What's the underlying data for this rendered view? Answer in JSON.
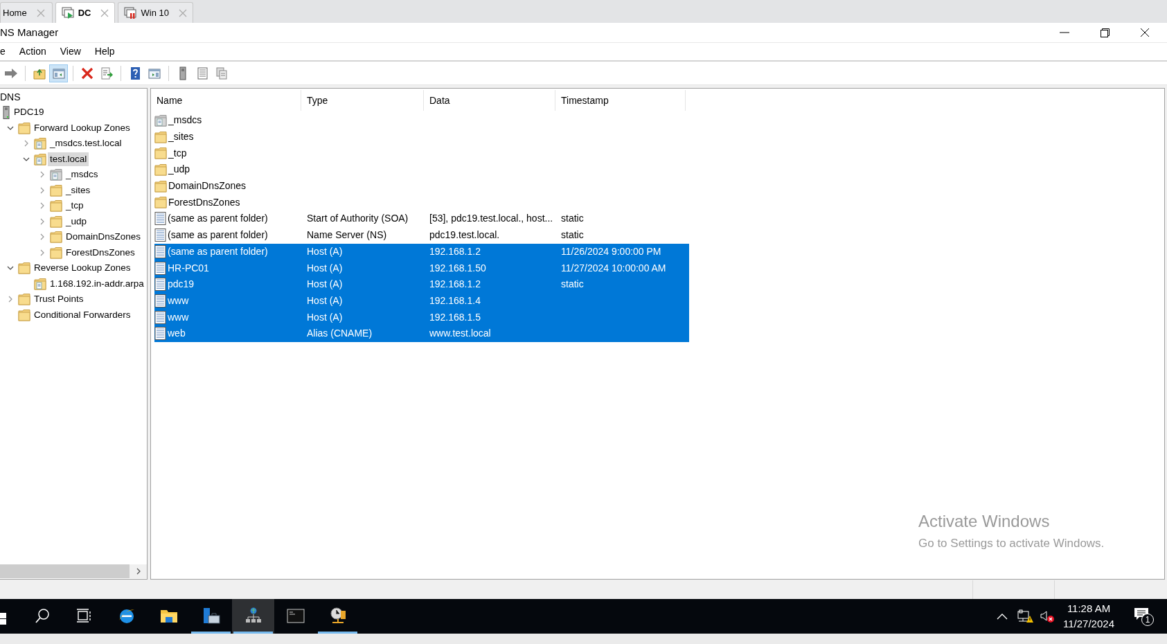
{
  "tabs": [
    {
      "label": "Home",
      "kind": "home",
      "selected": false
    },
    {
      "label": "DC",
      "kind": "running",
      "selected": true
    },
    {
      "label": "Win 10",
      "kind": "paused",
      "selected": false
    }
  ],
  "window": {
    "title": "NS Manager"
  },
  "menu": [
    "e",
    "Action",
    "View",
    "Help"
  ],
  "toolbar": [
    {
      "kind": "forward",
      "selected": false
    },
    {
      "kind": "up",
      "selected": false
    },
    {
      "kind": "tree",
      "selected": true
    },
    {
      "kind": "delete",
      "selected": false
    },
    {
      "kind": "export",
      "selected": false
    },
    {
      "kind": "help",
      "selected": false
    },
    {
      "kind": "action",
      "selected": false
    },
    {
      "kind": "server",
      "selected": false
    },
    {
      "kind": "list",
      "selected": false
    },
    {
      "kind": "copies",
      "selected": false
    }
  ],
  "tree": {
    "root": "DNS",
    "items": [
      {
        "label": "PDC19",
        "kind": "server",
        "selected": false,
        "children": [
          {
            "label": "Forward Lookup Zones",
            "kind": "folder",
            "expanded": true,
            "selected": false,
            "children": [
              {
                "label": "_msdcs.test.local",
                "kind": "zone",
                "expanded": false,
                "selected": false
              },
              {
                "label": "test.local",
                "kind": "zone",
                "expanded": true,
                "selected": true,
                "children": [
                  {
                    "label": "_msdcs",
                    "kind": "zone_grey",
                    "expanded": false,
                    "selected": false
                  },
                  {
                    "label": "_sites",
                    "kind": "folder",
                    "expanded": false,
                    "selected": false
                  },
                  {
                    "label": "_tcp",
                    "kind": "folder",
                    "expanded": false,
                    "selected": false
                  },
                  {
                    "label": "_udp",
                    "kind": "folder",
                    "expanded": false,
                    "selected": false
                  },
                  {
                    "label": "DomainDnsZones",
                    "kind": "folder",
                    "expanded": false,
                    "selected": false
                  },
                  {
                    "label": "ForestDnsZones",
                    "kind": "folder",
                    "expanded": false,
                    "selected": false
                  }
                ]
              }
            ]
          },
          {
            "label": "Reverse Lookup Zones",
            "kind": "folder",
            "expanded": true,
            "selected": false,
            "children": [
              {
                "label": "1.168.192.in-addr.arpa",
                "kind": "zone",
                "selected": false
              }
            ]
          },
          {
            "label": "Trust Points",
            "kind": "folder",
            "expanded": false,
            "selected": false
          },
          {
            "label": "Conditional Forwarders",
            "kind": "folder",
            "selected": false
          }
        ]
      }
    ]
  },
  "table": {
    "columns": [
      "Name",
      "Type",
      "Data",
      "Timestamp"
    ],
    "rows": [
      {
        "kind": "zone_grey",
        "selected": false,
        "cells": [
          "_msdcs"
        ]
      },
      {
        "kind": "folder",
        "selected": false,
        "cells": [
          "_sites"
        ]
      },
      {
        "kind": "folder",
        "selected": false,
        "cells": [
          "_tcp"
        ]
      },
      {
        "kind": "folder",
        "selected": false,
        "cells": [
          "_udp"
        ]
      },
      {
        "kind": "folder",
        "selected": false,
        "cells": [
          "DomainDnsZones"
        ]
      },
      {
        "kind": "folder",
        "selected": false,
        "cells": [
          "ForestDnsZones"
        ]
      },
      {
        "kind": "record",
        "selected": false,
        "cells": [
          "(same as parent folder)",
          "Start of Authority (SOA)",
          "[53], pdc19.test.local., host...",
          "static"
        ]
      },
      {
        "kind": "record",
        "selected": false,
        "cells": [
          "(same as parent folder)",
          "Name Server (NS)",
          "pdc19.test.local.",
          "static"
        ]
      },
      {
        "kind": "record",
        "selected": true,
        "cells": [
          "(same as parent folder)",
          "Host (A)",
          "192.168.1.2",
          "11/26/2024 9:00:00 PM"
        ]
      },
      {
        "kind": "record",
        "selected": true,
        "cells": [
          "HR-PC01",
          "Host (A)",
          "192.168.1.50",
          "11/27/2024 10:00:00 AM"
        ]
      },
      {
        "kind": "record",
        "selected": true,
        "cells": [
          "pdc19",
          "Host (A)",
          "192.168.1.2",
          "static"
        ]
      },
      {
        "kind": "record",
        "selected": true,
        "cells": [
          "www",
          "Host (A)",
          "192.168.1.4"
        ]
      },
      {
        "kind": "record",
        "selected": true,
        "cells": [
          "www",
          "Host (A)",
          "192.168.1.5"
        ]
      },
      {
        "kind": "record",
        "selected": true,
        "cells": [
          "web",
          "Alias (CNAME)",
          "www.test.local"
        ]
      }
    ]
  },
  "activation": {
    "title": "Activate Windows",
    "text": "Go to Settings to activate Windows."
  },
  "taskbar": {
    "apps": [
      {
        "kind": "start",
        "running": false,
        "active": false
      },
      {
        "kind": "search",
        "running": false,
        "active": false
      },
      {
        "kind": "taskview",
        "running": false,
        "active": false
      },
      {
        "kind": "browser",
        "running": false,
        "active": false
      },
      {
        "kind": "explorer",
        "running": false,
        "active": false
      },
      {
        "kind": "servermanager",
        "running": true,
        "active": false
      },
      {
        "kind": "dns",
        "running": true,
        "active": true
      },
      {
        "kind": "console",
        "running": false,
        "active": false
      },
      {
        "kind": "clock",
        "running": true,
        "active": false
      }
    ],
    "time": "11:28 AM",
    "date": "11/27/2024",
    "notifications": "1"
  }
}
